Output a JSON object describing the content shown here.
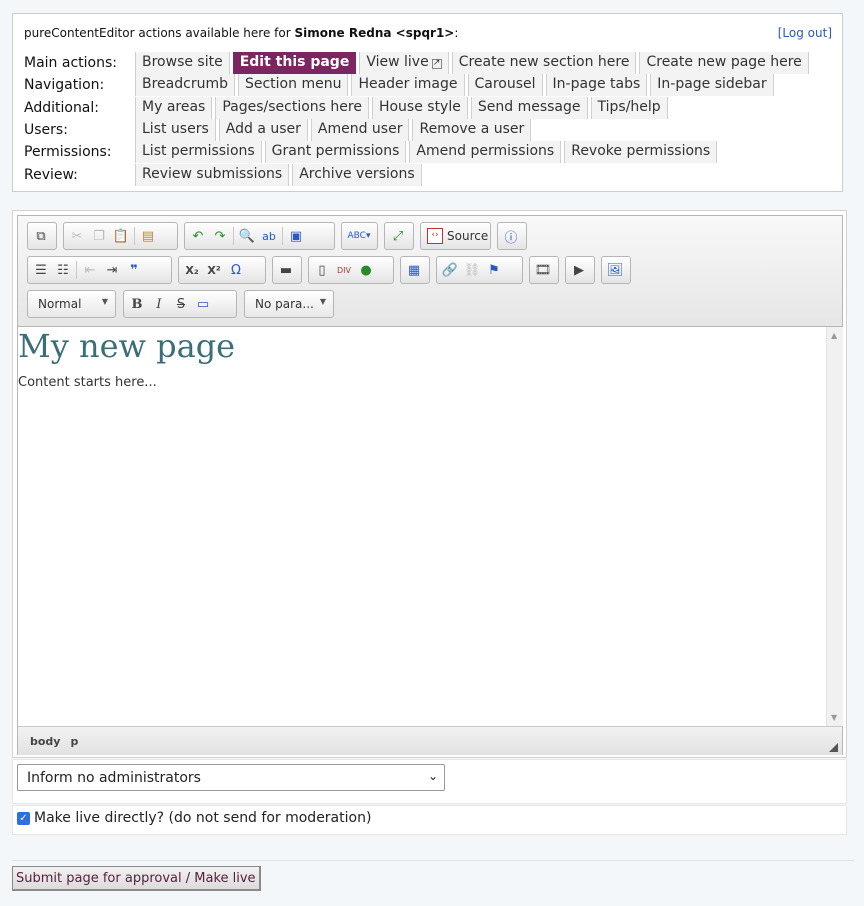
{
  "adminbar": {
    "intro_prefix": "pureContentEditor actions available here for",
    "user": "Simone Redna <spqr1>",
    "intro_suffix": ":",
    "logout": "[Log out]",
    "rows": [
      {
        "label": "Main actions:",
        "items": [
          "Browse site",
          "Edit this page",
          "View live",
          "Create new section here",
          "Create new page here"
        ]
      },
      {
        "label": "Navigation:",
        "items": [
          "Breadcrumb",
          "Section menu",
          "Header image",
          "Carousel",
          "In-page tabs",
          "In-page sidebar"
        ]
      },
      {
        "label": "Additional:",
        "items": [
          "My areas",
          "Pages/sections here",
          "House style",
          "Send message",
          "Tips/help"
        ]
      },
      {
        "label": "Users:",
        "items": [
          "List users",
          "Add a user",
          "Amend user",
          "Remove a user"
        ]
      },
      {
        "label": "Permissions:",
        "items": [
          "List permissions",
          "Grant permissions",
          "Amend permissions",
          "Revoke permissions"
        ]
      },
      {
        "label": "Review:",
        "items": [
          "Review submissions",
          "Archive versions"
        ]
      }
    ],
    "active_item": "Edit this page"
  },
  "toolbar": {
    "source_label": "Source",
    "format_combo": "Normal",
    "style_combo": "No para...",
    "icons": [
      "templates-icon",
      "cut-icon",
      "copy-icon",
      "paste-icon",
      "paste-word-icon",
      "undo-icon",
      "redo-icon",
      "find-icon",
      "replace-icon",
      "select-all-icon",
      "spellcheck-icon",
      "maximize-icon",
      "source-icon",
      "about-icon",
      "bulleted-list-icon",
      "numbered-list-icon",
      "outdent-icon",
      "indent-icon",
      "blockquote-icon",
      "subscript-icon",
      "superscript-icon",
      "special-char-icon",
      "horizontal-rule-icon",
      "templates-block-icon",
      "div-icon",
      "iframe-icon",
      "table-icon",
      "link-icon",
      "unlink-icon",
      "anchor-icon",
      "video-icon",
      "youtube-icon",
      "image-icon",
      "bold-icon",
      "italic-icon",
      "strike-icon",
      "remove-format-icon"
    ]
  },
  "editor": {
    "heading": "My new page",
    "body": "Content starts here...",
    "path": [
      "body",
      "p"
    ]
  },
  "form": {
    "notify_selected": "Inform no administrators",
    "make_live_label": "Make live directly? (do not send for moderation)",
    "make_live_checked": true,
    "submit_label": "Submit page for approval / Make live"
  }
}
